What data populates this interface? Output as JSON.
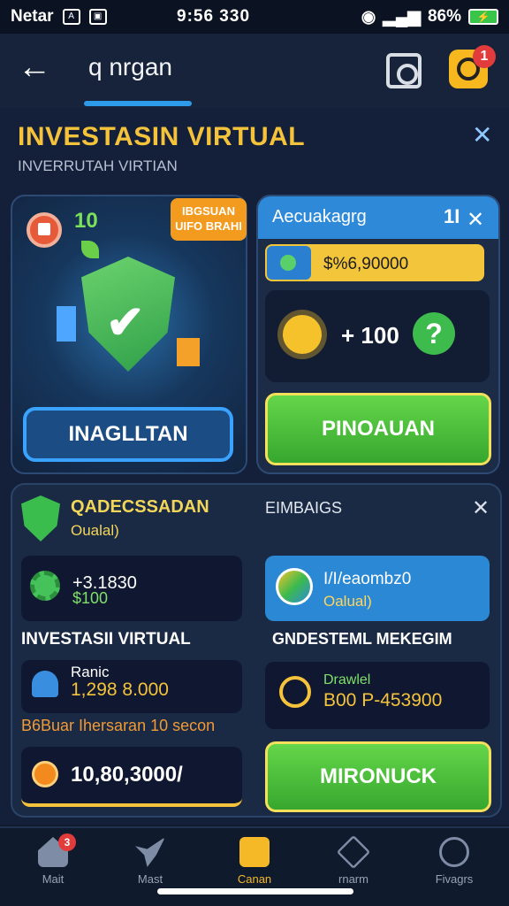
{
  "status_bar": {
    "carrier": "Netar",
    "box_icon": "Ⓐ",
    "mid_text": "9:56 330",
    "battery": "86%"
  },
  "header": {
    "title": "q nrgan",
    "notification_count": "1"
  },
  "page": {
    "title": "INVESTASIN VIRTUAL",
    "subtitle": "INVERRUTAH VIRTIAN"
  },
  "card_left": {
    "level": "10",
    "promo": "IBGSUAN UIFO BRAHI",
    "button": "INAGLLTAN"
  },
  "card_right": {
    "title": "Aecuakagrg",
    "count": "1I",
    "amount": "$%6,90000",
    "reward": "+ 100",
    "button": "PINOAUAN"
  },
  "section2": {
    "title": "QADECSSADAN",
    "subtitle": "Oualal)",
    "right_title": "EIMBAIGS",
    "stat_a_line1": "+3.1830",
    "stat_a_line2": "$100",
    "blue_card_title": "I/I/eaombz0",
    "blue_card_sub": "Oalual)",
    "label_left": "INVESTASII VIRTUAL",
    "label_right": "GNDESTEML MEKEGIM",
    "rank_label": "Ranic",
    "rank_value": "1,298 8.000",
    "target_label": "Drawlel",
    "target_value": "B00 P-453900",
    "orange_line": "B6Buar Ihersaran 10 secon",
    "coin_value": "10,80,3000/",
    "button": "MIRONUCK"
  },
  "bottom_nav": {
    "badge": "3",
    "items": [
      {
        "label": "Mait",
        "icon": "home-icon"
      },
      {
        "label": "Mast",
        "icon": "bird-icon"
      },
      {
        "label": "Canan",
        "icon": "grid-icon"
      },
      {
        "label": "rnarm",
        "icon": "hex-icon"
      },
      {
        "label": "Fivagrs",
        "icon": "user-icon"
      }
    ]
  },
  "colors": {
    "accent_gold": "#f5c33b",
    "accent_blue": "#2e8ad8",
    "accent_green": "#3dbb4c",
    "background": "#0f1a2e"
  }
}
